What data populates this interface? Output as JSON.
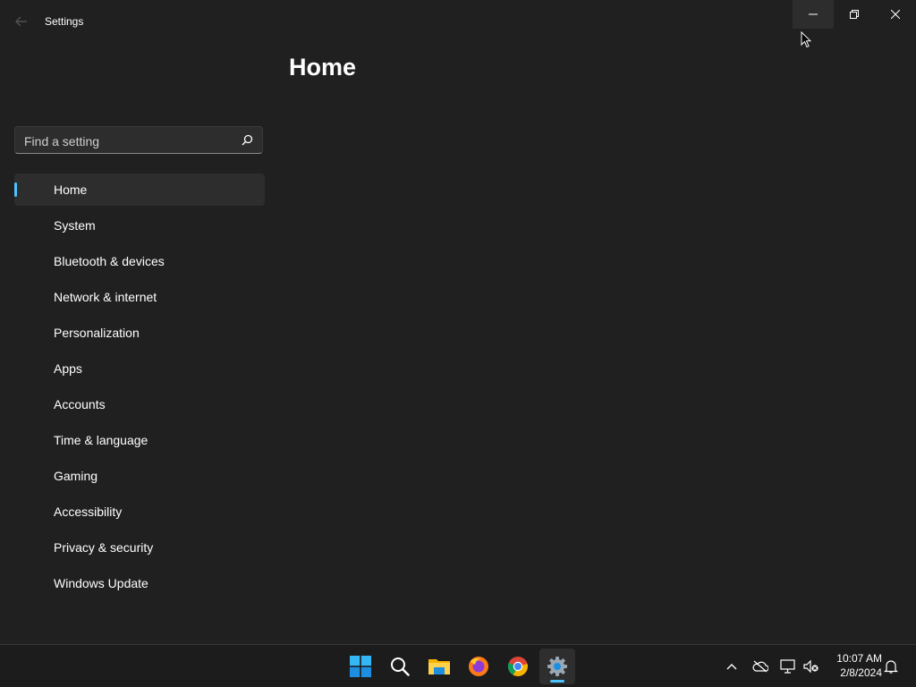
{
  "window": {
    "title": "Settings"
  },
  "search": {
    "placeholder": "Find a setting"
  },
  "sidebar": {
    "items": [
      {
        "label": "Home",
        "active": true
      },
      {
        "label": "System"
      },
      {
        "label": "Bluetooth & devices"
      },
      {
        "label": "Network & internet"
      },
      {
        "label": "Personalization"
      },
      {
        "label": "Apps"
      },
      {
        "label": "Accounts"
      },
      {
        "label": "Time & language"
      },
      {
        "label": "Gaming"
      },
      {
        "label": "Accessibility"
      },
      {
        "label": "Privacy & security"
      },
      {
        "label": "Windows Update"
      }
    ]
  },
  "main": {
    "title": "Home"
  },
  "taskbar": {
    "apps": [
      "start-icon",
      "search-icon",
      "file-explorer-icon",
      "firefox-icon",
      "chrome-icon",
      "settings-icon"
    ],
    "active_app": "settings-icon",
    "tray": [
      "chevron-up-icon",
      "onedrive-icon",
      "network-icon",
      "volume-muted-icon",
      "notification-bell-icon"
    ],
    "clock": {
      "time": "10:07 AM",
      "date": "2/8/2024"
    }
  },
  "colors": {
    "background": "#202020",
    "accent": "#4cc2ff",
    "taskbar": "#1c1c1c",
    "nav_selected": "#2d2d2d"
  }
}
